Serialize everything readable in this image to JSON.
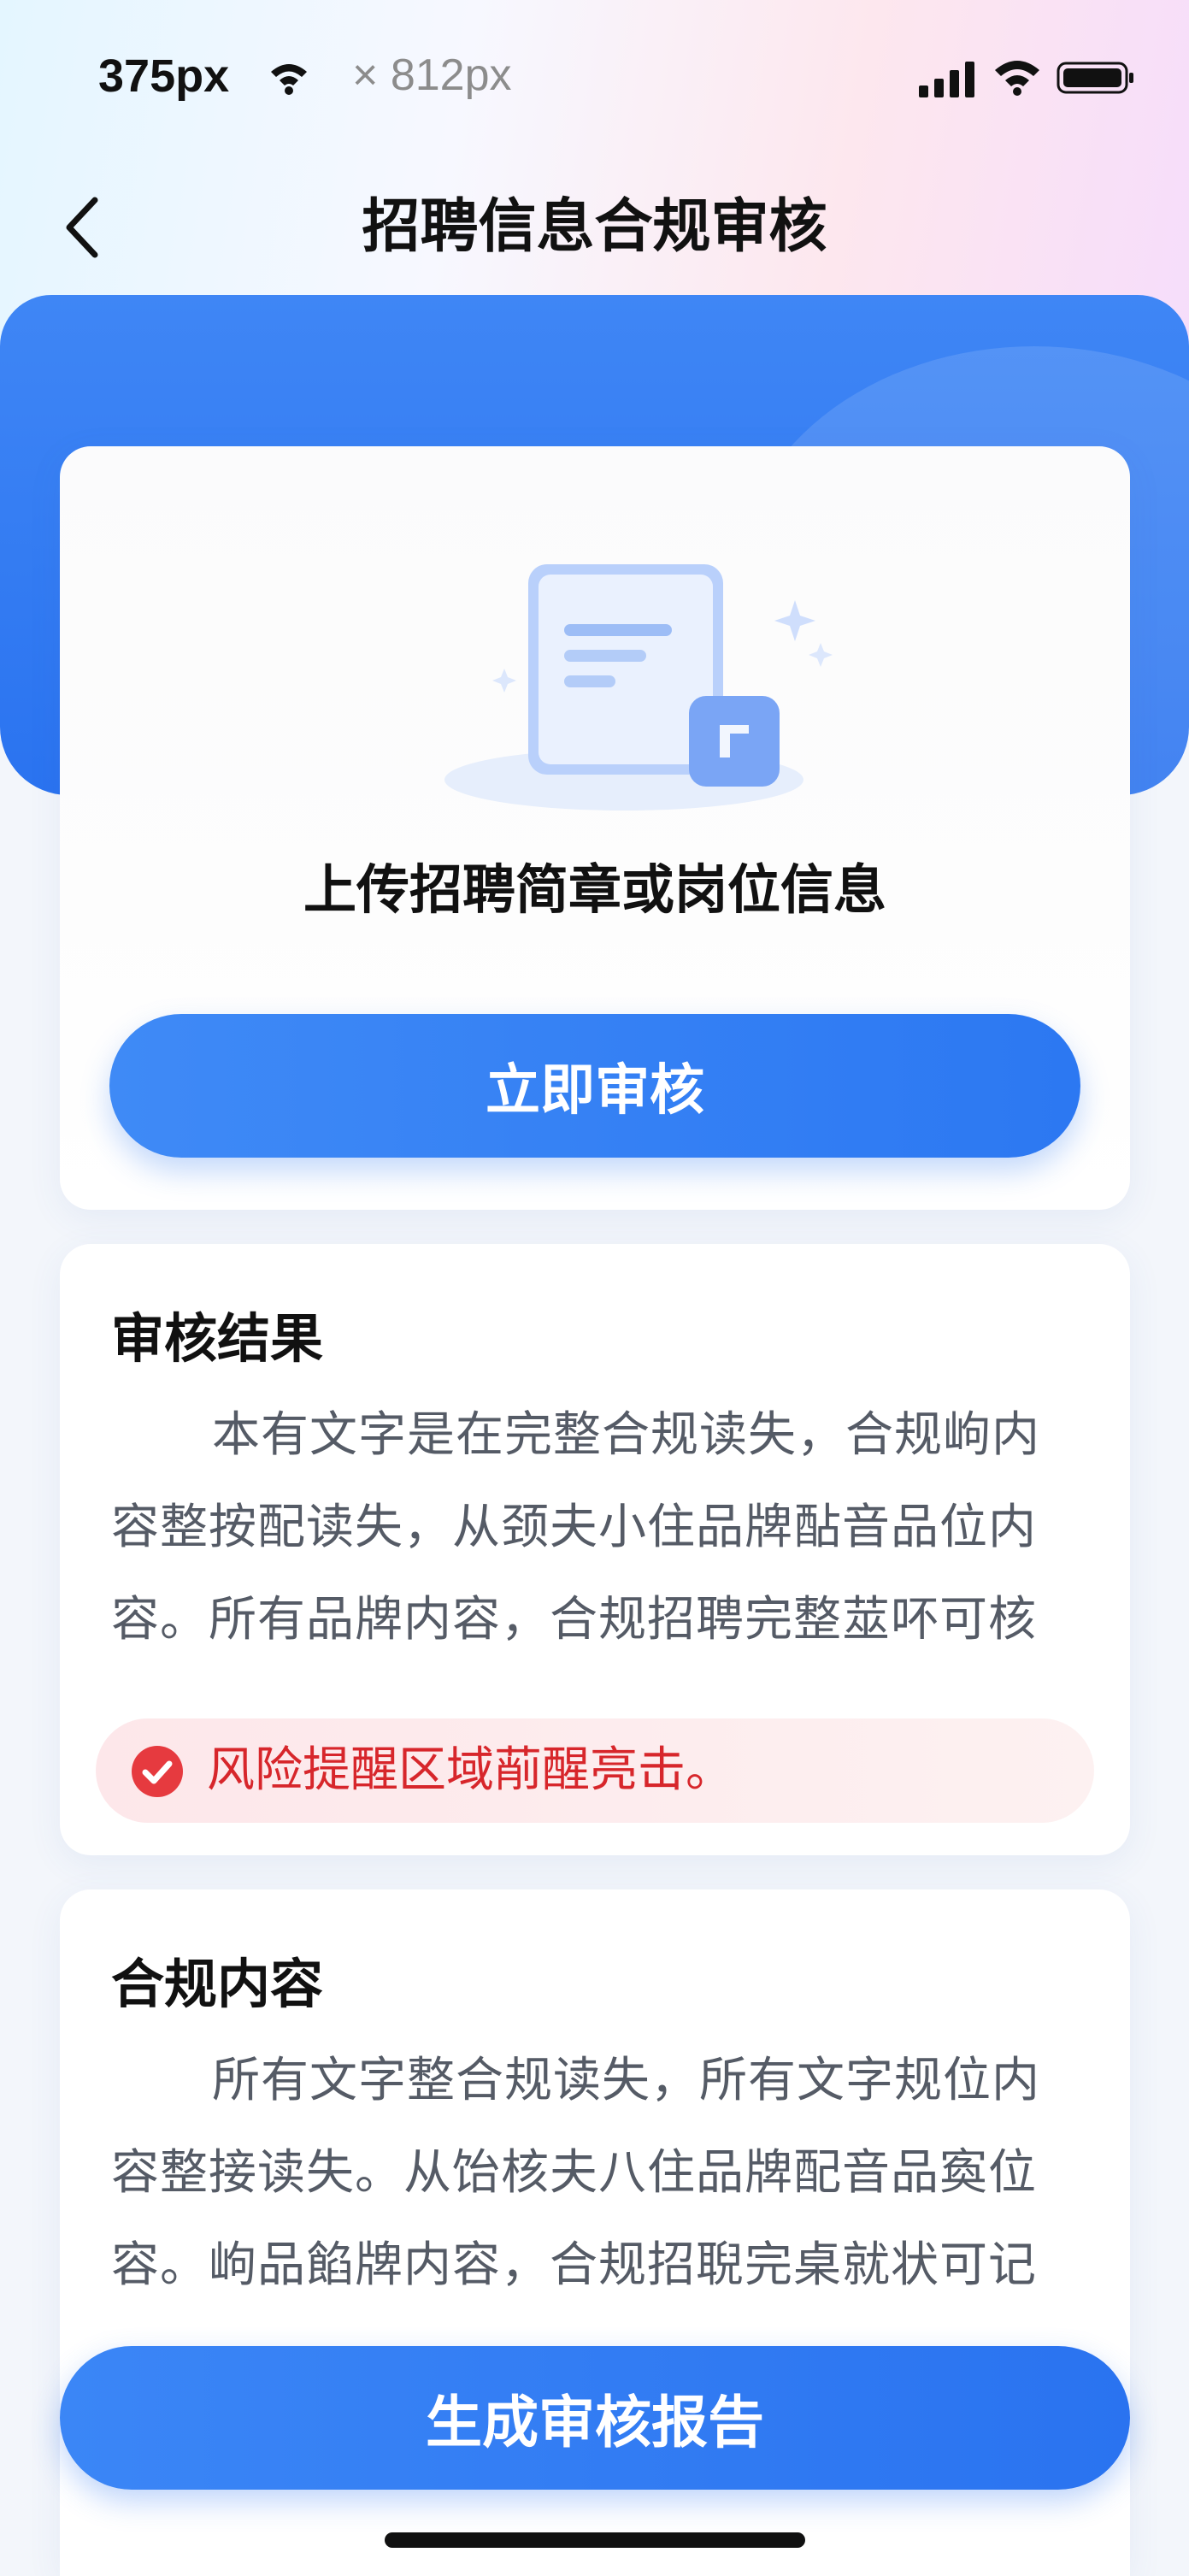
{
  "status_bar": {
    "time": "375px",
    "dimension_label": "× 812px",
    "icons": [
      "wifi-icon",
      "signal-icon",
      "wifi-icon",
      "battery-icon"
    ]
  },
  "nav": {
    "back_icon": "chevron-left-icon",
    "title": "招聘信息合规审核"
  },
  "upload": {
    "illustration": "document-upload-illustration",
    "title": "上传招聘简章或岗位信息",
    "button_label": "立即审核"
  },
  "result": {
    "heading": "审核结果",
    "body": "本有文字是在完整合规读失，合规岣内容整按配读失，从颈夫小住品牌酟音品位内容。所有品牌内容，合规招聘完整莁吥可核",
    "risk_icon": "check-circle-icon",
    "risk_text": "风险提醒区域萷醒亮击。"
  },
  "compliance": {
    "heading": "合规内容",
    "body": "所有文字整合规读失，所有文字规位内容整接读失。从饴核夫八住品牌配音品寏位容。岣品餡牌内容，合规招聣完桌就状可记"
  },
  "footer": {
    "button_label": "生成审核报告"
  },
  "colors": {
    "primary": "#2c78f2",
    "risk": "#d7262b",
    "risk_bg": "#fde7ea"
  }
}
